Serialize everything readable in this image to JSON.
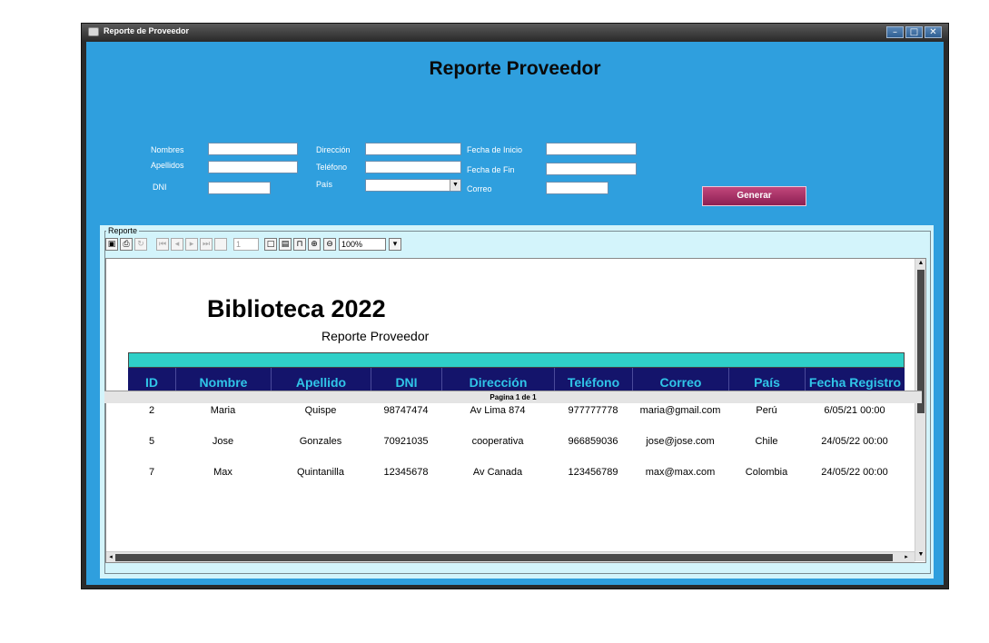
{
  "window": {
    "title": "Reporte de Proveedor",
    "minimize": "–",
    "maximize": "□",
    "close": "✕"
  },
  "form": {
    "heading": "Reporte Proveedor",
    "labels": {
      "nombres": "Nombres",
      "apellidos": "Apellidos",
      "dni": "DNI",
      "direccion": "Dirección",
      "telefono": "Teléfono",
      "pais": "País",
      "fecha_inicio": "Fecha de Inicio",
      "fecha_fin": "Fecha de Fin",
      "correo": "Correo"
    },
    "values": {
      "nombres": "",
      "apellidos": "",
      "dni": "",
      "direccion": "",
      "telefono": "",
      "pais": "",
      "fecha_inicio": "",
      "fecha_fin": "",
      "correo": ""
    },
    "generate_label": "Generar"
  },
  "report": {
    "legend": "Reporte",
    "toolbar": {
      "page_value": "1",
      "zoom_value": "100%",
      "icons": [
        "save-icon",
        "print-icon",
        "reload-icon",
        "first-page-icon",
        "previous-page-icon",
        "next-page-icon",
        "last-page-icon",
        "actual-size-icon",
        "fit-page-icon",
        "fit-width-icon",
        "zoom-in-icon",
        "zoom-out-icon"
      ]
    },
    "title": "Biblioteca 2022",
    "subtitle": "Reporte Proveedor",
    "columns": [
      "ID",
      "Nombre",
      "Apellido",
      "DNI",
      "Dirección",
      "Teléfono",
      "Correo",
      "País",
      "Fecha Registro"
    ],
    "rows": [
      [
        "2",
        "Maria",
        "Quispe",
        "98747474",
        "Av Lima 874",
        "977777778",
        "maria@gmail.com",
        "Perú",
        "6/05/21 00:00"
      ],
      [
        "5",
        "Jose",
        "Gonzales",
        "70921035",
        "cooperativa",
        "966859036",
        "jose@jose.com",
        "Chile",
        "24/05/22 00:00"
      ],
      [
        "7",
        "Max",
        "Quintanilla",
        "12345678",
        "Av Canada",
        "123456789",
        "max@max.com",
        "Colombia",
        "24/05/22 00:00"
      ]
    ],
    "status": "Pagina 1 de 1"
  },
  "colors": {
    "form_background": "#2f9fde",
    "generate_button": "#a83268",
    "table_header_background": "#14146b",
    "table_header_text": "#30c5e8",
    "teal_band": "#2fd0c8",
    "report_panel": "#d3f4fb"
  }
}
